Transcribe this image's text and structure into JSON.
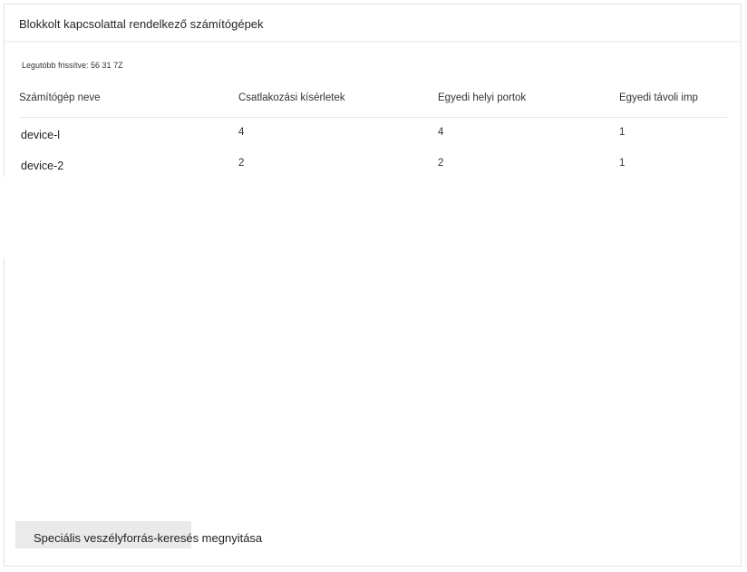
{
  "card": {
    "title": "Blokkolt kapcsolattal rendelkező számítógépek",
    "last_updated": "Legutóbb frissítve: 56 31 7Z"
  },
  "table": {
    "headers": {
      "name": "Számítógép neve",
      "attempts": "Csatlakozási kísérletek",
      "local_ports": "Egyedi helyi portok",
      "remote_ips": "Egyedi távoli imp"
    },
    "rows": [
      {
        "name": "device-l",
        "attempts": "4",
        "local_ports": "4",
        "remote_ips": "1"
      },
      {
        "name": "device-2",
        "attempts": "2",
        "local_ports": "2",
        "remote_ips": "1"
      }
    ]
  },
  "actions": {
    "open_hunting_label": "Speciális veszélyforrás-keresés megnyitása"
  },
  "colors": {
    "button_bg": "#eaeaea",
    "border": "#e3e3e3",
    "text": "#222222"
  }
}
